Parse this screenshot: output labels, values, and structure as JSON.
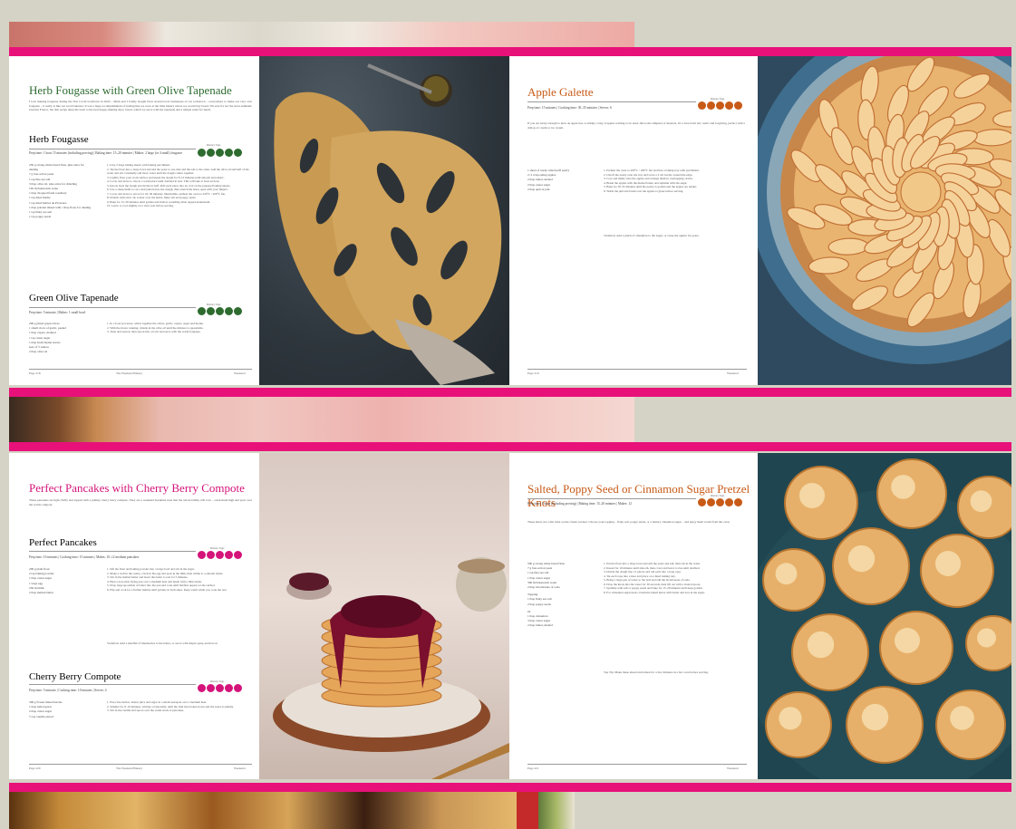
{
  "colors": {
    "magenta": "#e8117a",
    "green": "#2d6b2f",
    "orange": "#c85a17",
    "pink": "#d4147a",
    "background": "#d5d3c6"
  },
  "spread1": {
    "left_page": {
      "title": "Herb Fougasse with Green Olive Tapenade",
      "intro": "I love making fougasse during the first Covid lockdown in 2020 – Mum and I fondly bought flour around local businesses of our lockdown – everywhere to make our very own fougasse – it really is like our local bakeries. It was a huge accomplishment of feeling like we were at the little bakery where we would buy bread. I'm sure it's not the most authentic bread in France, but this recipe takes me back to the best happy-making days; bread, which we serve with the tapenade and a simple salad for lunch.",
      "recipe1": {
        "heading": "Herb Fougasse",
        "meta": "Prep time: 1 hour 15 minutes (including proving) | Baking time: 15–20 minutes | Makes: 2 large (or 4 small) fougasse",
        "diet_label": "Dietary Tags",
        "ingredients": [
          "250 g strong white bread flour, plus extra for dusting",
          "7 g fast-action yeast",
          "1 tsp fine sea salt",
          "3 tbsp olive oil, plus extra for drizzling",
          "165 ml lukewarm water",
          "1 tbsp chopped fresh rosemary",
          "1 tsp dried thyme",
          "1 tsp dried herbes de Provence",
          "1 tbsp polenta mixed with 1 tbsp flour, for dusting",
          "1 tsp flaky sea salt",
          "1 tsp poppy seeds"
        ],
        "steps": [
          "1. Line 2 large baking sheets with baking parchment.",
          "2. Tip the flour into a large bowl and add the yeast to one side and the salt to the other. Add the olive oil and half of the water and stir. Gradually add more water until the dough comes together.",
          "3. Lightly flour your work surface and knead the dough for 8–10 minutes until smooth and elastic.",
          "4. Cover and leave to rise in a warm place until doubled in size. This will take at least an hour.",
          "5. Knock back the dough and divide in half. Roll each piece into an oval on the prepared baking sheets.",
          "6. Use a sharp knife to cut a leaf pattern into the dough, then stretch the holes open with your fingers.",
          "7. Cover and leave to prove for 20–30 minutes. Meanwhile, preheat the oven to 220°C / 200°C fan.",
          "8. Drizzle with olive oil, scatter over the herbs, flaky salt and poppy seeds.",
          "9. Bake for 15–20 minutes until golden and hollow sounding when tapped underneath.",
          "10. Leave to cool slightly on a wire rack before serving."
        ]
      },
      "recipe2": {
        "heading": "Green Olive Tapenade",
        "meta": "Prep time: 5 minutes | Makes: 1 small bowl",
        "diet_label": "Dietary Tags",
        "ingredients": [
          "200 g pitted green olives",
          "1 small clove of garlic, peeled",
          "1 tbsp capers, drained",
          "1 tsp caster sugar",
          "1 tbsp fresh thyme leaves",
          "zest of ½ lemon",
          "2 tbsp olive oil"
        ],
        "steps": [
          "1. In a food processor, whizz together the olives, garlic, capers, sugar and thyme.",
          "2. With the motor running, drizzle in the olive oil until the mixture is spreadable.",
          "3. Taste and season, then spoon into a bowl and serve with the warm fougasse."
        ]
      },
      "footer_left": "Page 218",
      "footer_center": "The Weekend Bakery",
      "footer_right": "Weekend"
    },
    "right_page": {
      "title": "Apple Galette",
      "meta": "Prep time: 15 minutes | Cooking time: 30–35 minutes | Serves: 6",
      "diet_label": "Dietary Tags",
      "intro": "If you are lucky enough to have an apple tree or simply a bag of apples waiting to be used, this is the simplest of desserts. It's a free-form tart, rustic and forgiving, perfect with a dollop of cream or ice cream.",
      "ingredients": [
        "1 sheet of ready-rolled puff pastry",
        "2–3 crisp eating apples",
        "2 tbsp butter, melted",
        "2 tbsp caster sugar",
        "2 tbsp apricot jam"
      ],
      "steps": [
        "1. Preheat the oven to 200°C / 180°C fan and line a baking tray with parchment.",
        "2. Unroll the pastry onto the tray and score a 2 cm border around the edge.",
        "3. Core and thinly slice the apples and arrange them in overlapping circles.",
        "4. Brush the apples with the melted butter and sprinkle with the sugar.",
        "5. Bake for 30–35 minutes until the pastry is golden and the apples are tender.",
        "6. Warm the jam and brush over the apples to glaze before serving."
      ],
      "variation": "Variation: Add a pinch of cinnamon to the sugar, or swap the apples for pears.",
      "footer_left": "Page 219",
      "footer_right": "Weekend"
    }
  },
  "spread2": {
    "left_page": {
      "title": "Perfect Pancakes with Cherry Berry Compote",
      "intro": "These pancakes are light, fluffy and topped with a jammy cherry berry compote. They are a weekend breakfast treat that the whole family will love – stack them high and pour over the warm compote.",
      "recipe1": {
        "heading": "Perfect Pancakes",
        "meta": "Prep time: 10 minutes | Cooking time: 15 minutes | Makes: 10–12 medium pancakes",
        "diet_label": "Dietary Tags",
        "ingredients": [
          "200 g plain flour",
          "2 tsp baking powder",
          "1 tbsp caster sugar",
          "1 large egg",
          "250 ml milk",
          "2 tbsp melted butter"
        ],
        "steps": [
          "1. Sift the flour and baking powder into a large bowl and stir in the sugar.",
          "2. Make a well in the centre, crack in the egg and pour in the milk, then whisk to a smooth batter.",
          "3. Stir in the melted butter and leave the batter to rest for 5 minutes.",
          "4. Heat a non-stick frying pan over a medium heat and brush with a little butter.",
          "5. Drop large spoonfuls of batter into the pan and cook until bubbles appear on the surface.",
          "6. Flip and cook for a further minute until golden on both sides. Keep warm while you cook the rest."
        ],
        "variation": "Variation: Add a handful of blueberries to the batter, or serve with maple syrup and bacon."
      },
      "recipe2": {
        "heading": "Cherry Berry Compote",
        "meta": "Prep time: 5 minutes | Cooking time: 10 minutes | Serves: 4",
        "diet_label": "Dietary Tags",
        "ingredients": [
          "300 g frozen mixed berries",
          "1 tbsp lemon juice",
          "2 tbsp caster sugar",
          "½ tsp vanilla extract"
        ],
        "steps": [
          "1. Place the berries, lemon juice and sugar in a small saucepan over a medium heat.",
          "2. Simmer for 8–10 minutes, stirring occasionally, until the fruit has broken down and the sauce is jammy.",
          "3. Stir in the vanilla and spoon over the warm stack of pancakes."
        ]
      },
      "footer_left": "Page 220",
      "footer_center": "The Weekend Bakery",
      "footer_right": "Weekend"
    },
    "right_page": {
      "title": "Salted, Poppy Seed or Cinnamon Sugar Pretzel Knots",
      "meta": "Prep time: 1 hour (including proving) | Baking time: 15–20 minutes | Makes: 12",
      "diet_label": "Dietary Tags",
      "intro": "These knots are a fun twist on the classic pretzel. Choose your topping – flaky salt, poppy seeds, or a buttery cinnamon sugar – and enjoy them warm from the oven.",
      "ingredients": [
        "500 g strong white bread flour",
        "7 g fast-action yeast",
        "1 tsp fine sea salt",
        "1 tbsp caster sugar",
        "300 ml lukewarm water",
        "2 tbsp bicarbonate of soda",
        "",
        "Topping",
        "1 tbsp flaky sea salt",
        "2 tbsp poppy seeds",
        "",
        "Or",
        "1 tbsp cinnamon",
        "3 tbsp caster sugar",
        "2 tbsp butter, melted"
      ],
      "steps": [
        "1. Put the flour into a large bowl and add the yeast and salt, then stir in the water.",
        "2. Knead for 10 minutes until smooth, then cover and leave to rise until doubled.",
        "3. Divide the dough into 12 pieces and roll each into a long rope.",
        "4. Tie each rope into a knot and place on a lined baking tray.",
        "5. Bring a large pan of water to the boil and add the bicarbonate of soda.",
        "6. Drop the knots into the water for 30 seconds, then lift out with a slotted spoon.",
        "7. Sprinkle with salt or poppy seeds and bake for 15–20 minutes until deep golden.",
        "8. For cinnamon sugar knots, brush the baked knots with butter and toss in the sugar."
      ],
      "top_tip": "Top Tip: Make these ahead and reheat for a few minutes in a hot oven before serving.",
      "footer_left": "Page 221",
      "footer_right": "Weekend"
    }
  }
}
